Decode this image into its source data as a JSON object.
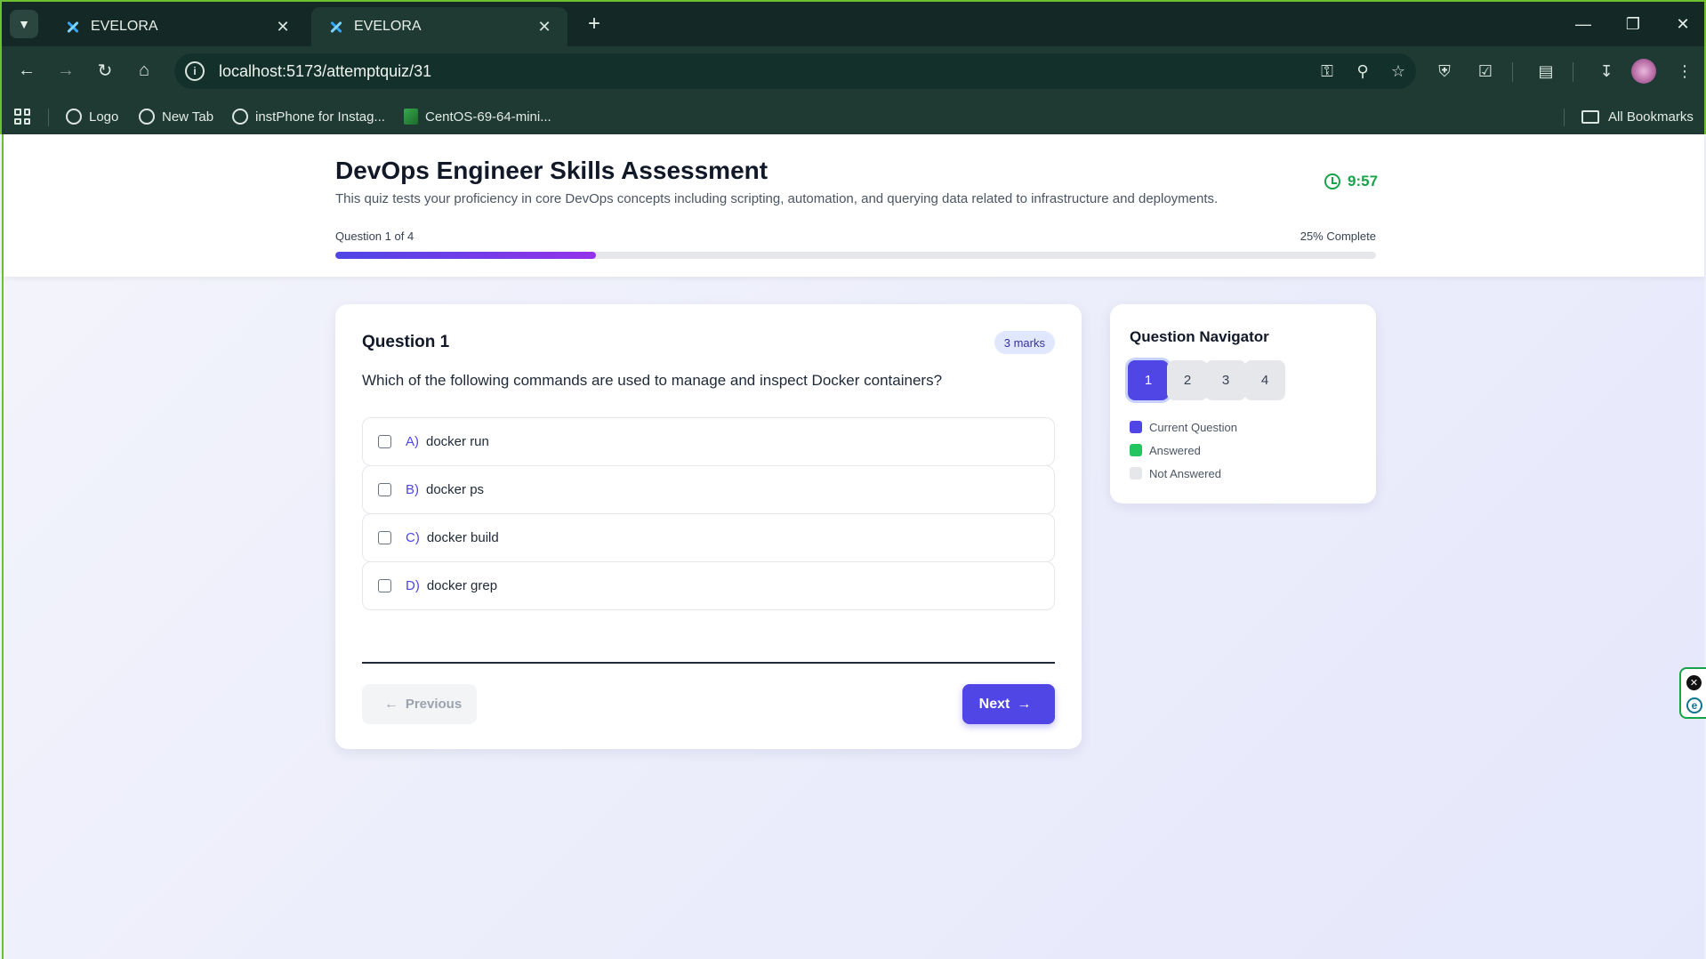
{
  "browser": {
    "tabs": [
      {
        "title": "EVELORA",
        "active": false
      },
      {
        "title": "EVELORA",
        "active": true
      }
    ],
    "url": "localhost:5173/attemptquiz/31",
    "bookmarks": [
      {
        "label": "Logo"
      },
      {
        "label": "New Tab"
      },
      {
        "label": "instPhone for Instag..."
      },
      {
        "label": "CentOS-69-64-mini..."
      }
    ],
    "all_bookmarks_label": "All Bookmarks"
  },
  "quiz": {
    "title": "DevOps Engineer Skills Assessment",
    "description": "This quiz tests your proficiency in core DevOps concepts including scripting, automation, and querying data related to infrastructure and deployments.",
    "timer": "9:57",
    "progress_label": "Question 1 of 4",
    "percent_label": "25% Complete",
    "progress_fraction": 0.25
  },
  "question": {
    "label": "Question 1",
    "marks": "3 marks",
    "text": "Which of the following commands are used to manage and inspect Docker containers?",
    "options": [
      {
        "letter": "A)",
        "text": "docker run"
      },
      {
        "letter": "B)",
        "text": "docker ps"
      },
      {
        "letter": "C)",
        "text": "docker build"
      },
      {
        "letter": "D)",
        "text": "docker grep"
      }
    ],
    "prev_label": "Previous",
    "next_label": "Next"
  },
  "navigator": {
    "title": "Question Navigator",
    "numbers": [
      "1",
      "2",
      "3",
      "4"
    ],
    "current": "1",
    "legend": [
      {
        "label": "Current Question",
        "color": "#4f46e5"
      },
      {
        "label": "Answered",
        "color": "#22c55e"
      },
      {
        "label": "Not Answered",
        "color": "#e5e7eb"
      }
    ]
  }
}
